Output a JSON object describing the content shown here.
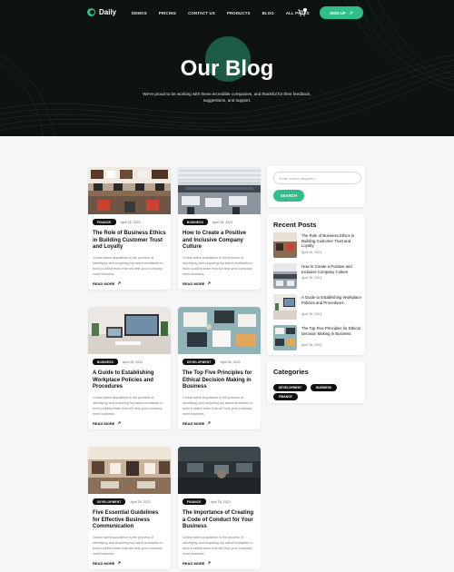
{
  "nav": {
    "logo": "Daily",
    "menu": [
      "DEMOS",
      "PRICING",
      "CONTACT US",
      "PRODUCTS",
      "BLOG",
      "ALL PAGES"
    ],
    "signup": "SIGN UP",
    "cart_icon": "cart-icon",
    "arrow_icon": "arrow-up-right-icon"
  },
  "hero": {
    "title": "Our Blog",
    "subtitle": "We're proud to be working with these incredible companies, and thankful for their feedback, suggestions, and support."
  },
  "posts": [
    {
      "tag": "FINANCE",
      "date": "April 26, 2023",
      "title": "The Role of Business Ethics in Building Customer Trust and Loyalty",
      "desc": "Global talent acquisition is the process of identifying and acquiring top talent worldwide to build a skilled team that will help your company meet business",
      "more": "READ MORE"
    },
    {
      "tag": "BUSINESS",
      "date": "April 26, 2023",
      "title": "How to Create a Positive and Inclusive Company Culture",
      "desc": "Global talent acquisition is the process of identifying and acquiring top talent worldwide to build a skilled team that will help your company meet business",
      "more": "READ MORE"
    },
    {
      "tag": "BUSINESS",
      "date": "April 26, 2023",
      "title": "A Guide to Establishing Workplace Policies and Procedures",
      "desc": "Global talent acquisition is the process of identifying and acquiring top talent worldwide to build a skilled team that will help your company meet business",
      "more": "READ MORE"
    },
    {
      "tag": "DEVELOPMENT",
      "date": "April 26, 2023",
      "title": "The Top Five Principles for Ethical Decision Making in Business",
      "desc": "Global talent acquisition is the process of identifying and acquiring top talent worldwide to build a skilled team that will help your company meet business",
      "more": "READ MORE"
    },
    {
      "tag": "DEVELOPMENT",
      "date": "April 26, 2023",
      "title": "Five Essential Guidelines for Effective Business Communication",
      "desc": "Global talent acquisition is the process of identifying and acquiring top talent worldwide to build a skilled team that will help your company meet business",
      "more": "READ MORE"
    },
    {
      "tag": "FINANCE",
      "date": "April 26, 2023",
      "title": "The Importance of Creating a Code of Conduct for Your Business",
      "desc": "Global talent acquisition is the process of identifying and acquiring top talent worldwide to build a skilled team that will help your company meet business",
      "more": "READ MORE"
    }
  ],
  "sidebar": {
    "search_placeholder": "Enter search keyword",
    "search_button": "SEARCH",
    "recent_heading": "Recent Posts",
    "recent": [
      {
        "title": "The Role of Business Ethics in Building Customer Trust and Loyalty",
        "date": "April 26, 2023"
      },
      {
        "title": "How to Create a Positive and Inclusive Company Culture",
        "date": "April 26, 2023"
      },
      {
        "title": "A Guide to Establishing Workplace Policies and Procedures",
        "date": "April 26, 2023"
      },
      {
        "title": "The Top Five Principles for Ethical Decision Making in Business",
        "date": "April 26, 2023"
      }
    ],
    "categories_heading": "Categories",
    "categories": [
      "DEVELOPMENT",
      "BUSINESS",
      "FINANCE"
    ]
  },
  "colors": {
    "accent": "#2fbf8a",
    "hero_bg": "#0e1312",
    "tag_bg": "#111111"
  }
}
